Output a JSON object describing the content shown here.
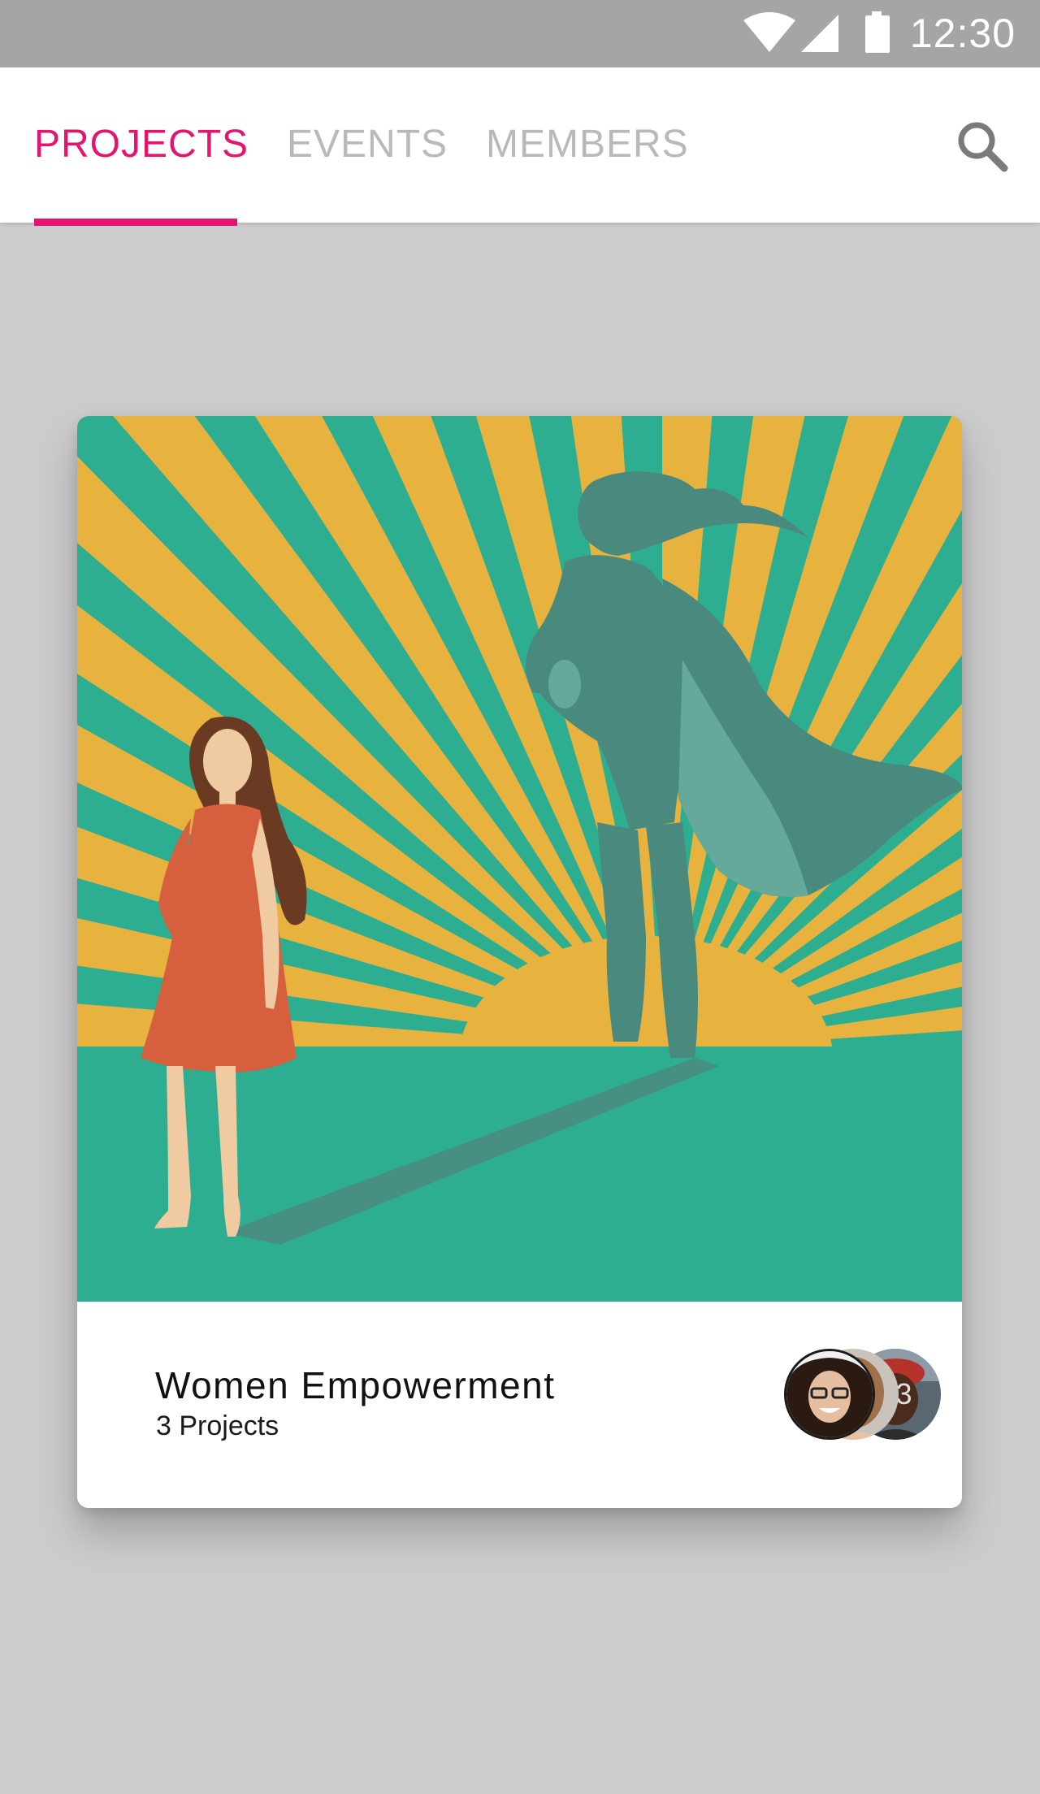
{
  "status_bar": {
    "time": "12:30",
    "icons": [
      "wifi-icon",
      "cell-signal-icon",
      "battery-icon"
    ]
  },
  "tabs": [
    {
      "label": "PROJECTS",
      "active": true
    },
    {
      "label": "EVENTS",
      "active": false
    },
    {
      "label": "MEMBERS",
      "active": false
    }
  ],
  "toolbar": {
    "search_icon": "search-icon"
  },
  "card": {
    "title": "Women Empowerment",
    "subtitle": "3 Projects",
    "illustration": "woman-superhero-shadow-illustration",
    "members_more_label": "+3"
  },
  "colors": {
    "accent": "#e5156f",
    "tab_inactive": "#b9b9b9",
    "background": "#cccccc",
    "status_bar": "#a5a5a5",
    "illustration_teal": "#2eae91",
    "illustration_yellow": "#e7b33e",
    "dress_red": "#d65f3e"
  }
}
